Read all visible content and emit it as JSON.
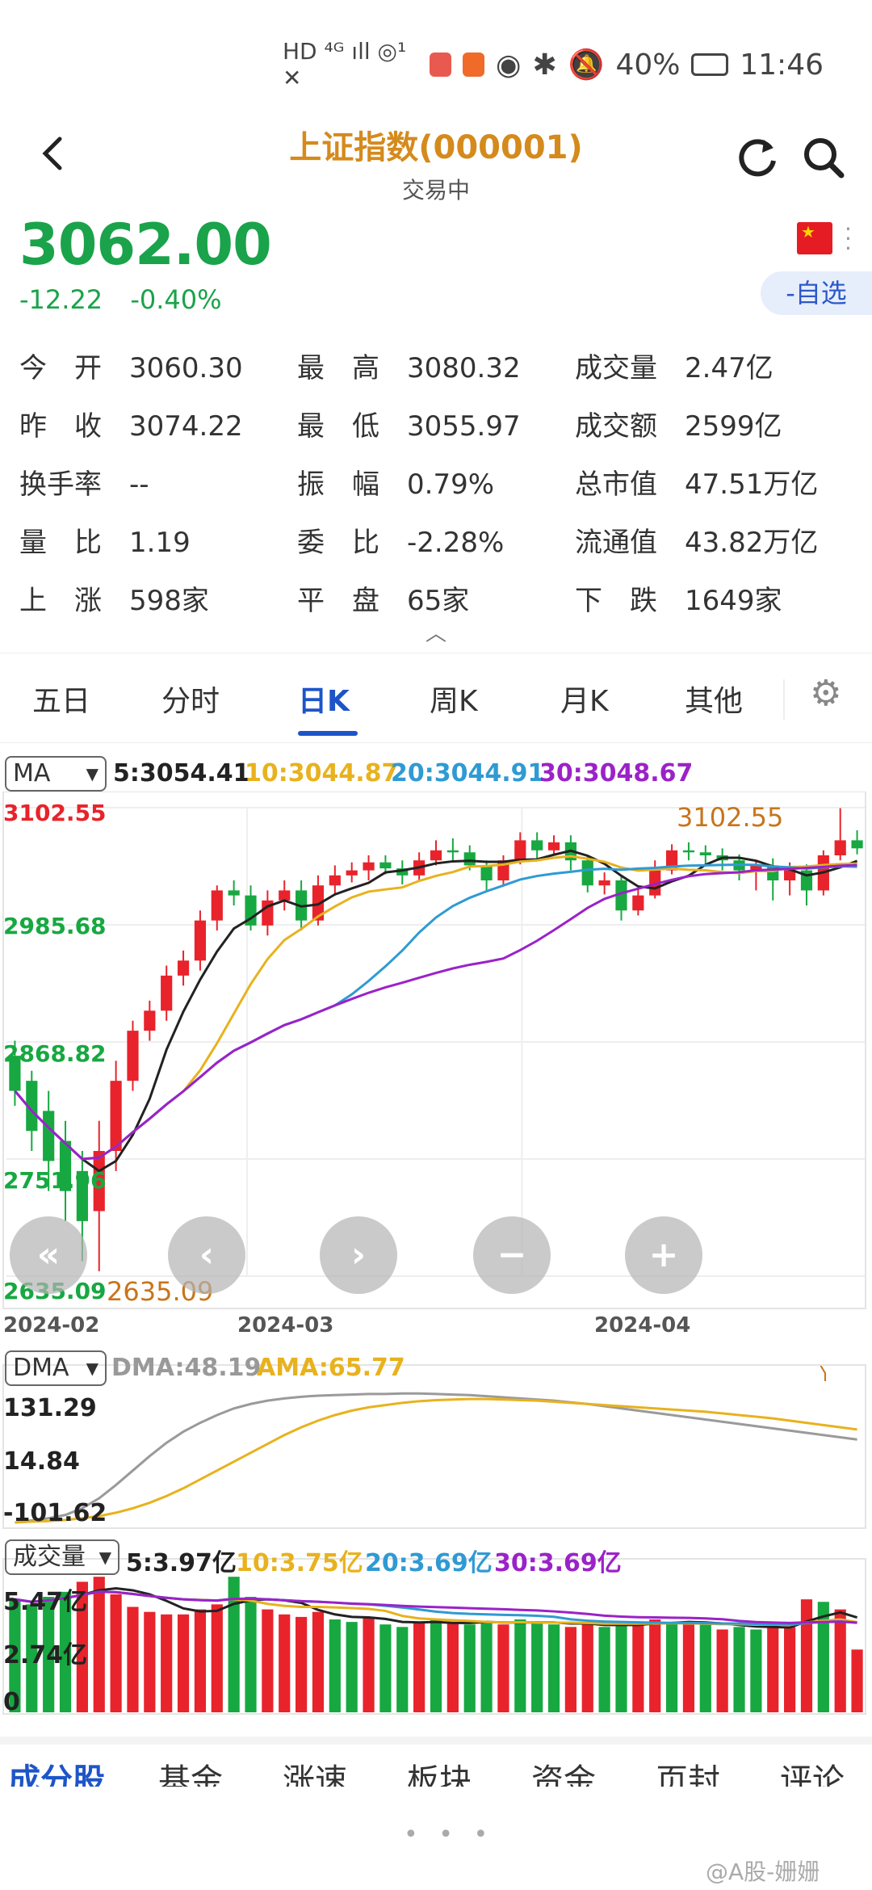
{
  "status_bar": {
    "left_icons": "HD ⁴ᴳ ıll ◎¹ ✕",
    "battery": "40%",
    "time": "11:46"
  },
  "header": {
    "title": "上证指数(000001)",
    "subtitle": "交易中",
    "back_icon": "chevron-left-icon",
    "refresh_icon": "refresh-icon",
    "search_icon": "search-icon"
  },
  "price": {
    "value": "3062.00",
    "change": "-12.22",
    "change_pct": "-0.40%",
    "watch_label": "-自选"
  },
  "quote": [
    [
      {
        "label": "今　开",
        "value": "3060.30"
      },
      {
        "label": "最　高",
        "value": "3080.32"
      },
      {
        "label": "成交量",
        "value": "2.47亿"
      }
    ],
    [
      {
        "label": "昨　收",
        "value": "3074.22"
      },
      {
        "label": "最　低",
        "value": "3055.97"
      },
      {
        "label": "成交额",
        "value": "2599亿"
      }
    ],
    [
      {
        "label": "换手率",
        "value": "--"
      },
      {
        "label": "振　幅",
        "value": "0.79%"
      },
      {
        "label": "总市值",
        "value": "47.51万亿"
      }
    ],
    [
      {
        "label": "量　比",
        "value": "1.19"
      },
      {
        "label": "委　比",
        "value": "-2.28%"
      },
      {
        "label": "流通值",
        "value": "43.82万亿"
      }
    ],
    [
      {
        "label": "上　涨",
        "value": "598家"
      },
      {
        "label": "平　盘",
        "value": "65家"
      },
      {
        "label": "下　跌",
        "value": "1649家"
      }
    ]
  ],
  "tabs": [
    "五日",
    "分时",
    "日K",
    "周K",
    "月K",
    "其他"
  ],
  "active_tab": "日K",
  "ma": {
    "selector": "MA",
    "ma5": "5:3054.41",
    "ma10": "10:3044.87",
    "ma20": "20:3044.91",
    "ma30": "30:3048.67"
  },
  "kline": {
    "y_top": "3102.55",
    "y_mid": "2985.68",
    "y_mid2": "2868.82",
    "y_low": "2751.96",
    "y_bottom": "2635.09",
    "high_note": "3102.55",
    "low_note": "2635.09",
    "dates": [
      "2024-02",
      "2024-03",
      "2024-04"
    ]
  },
  "dma": {
    "selector": "DMA",
    "dma": "DMA:48.19",
    "ama": "AMA:65.77",
    "y_top": "131.29",
    "y_mid": "14.84",
    "y_bottom": "-101.62"
  },
  "vol": {
    "selector": "成交量",
    "v5": "5:3.97亿",
    "v10": "10:3.75亿",
    "v20": "20:3.69亿",
    "v30": "30:3.69亿",
    "y_top": "5.47亿",
    "y_mid": "2.74亿",
    "y_bottom": "0"
  },
  "bottom_tabs": [
    "成分股",
    "基金",
    "涨速",
    "板块",
    "资金",
    "页封",
    "评论"
  ],
  "pager": "• • •",
  "watermark": "@A股-姗姗",
  "colors": {
    "up": "#e8232b",
    "down": "#17a841",
    "ma5": "#222222",
    "ma10": "#e8b21e",
    "ma20": "#2f9ad3",
    "ma30": "#9b22c8",
    "accent": "#1d55c8",
    "title": "#d58a1c"
  },
  "chart_data": {
    "type": "candlestick",
    "period": "daily",
    "ylim": [
      2635.09,
      3102.55
    ],
    "x_ticks": [
      "2024-02",
      "2024-03",
      "2024-04"
    ],
    "candles": [
      [
        2855,
        2820,
        2870,
        2805
      ],
      [
        2830,
        2780,
        2840,
        2760
      ],
      [
        2800,
        2750,
        2820,
        2720
      ],
      [
        2770,
        2720,
        2790,
        2690
      ],
      [
        2740,
        2690,
        2760,
        2650
      ],
      [
        2700,
        2760,
        2790,
        2640
      ],
      [
        2760,
        2830,
        2850,
        2740
      ],
      [
        2830,
        2880,
        2890,
        2820
      ],
      [
        2880,
        2900,
        2910,
        2870
      ],
      [
        2900,
        2935,
        2945,
        2890
      ],
      [
        2935,
        2950,
        2960,
        2925
      ],
      [
        2950,
        2990,
        3000,
        2940
      ],
      [
        2990,
        3020,
        3025,
        2980
      ],
      [
        3020,
        3015,
        3030,
        3005
      ],
      [
        3015,
        2985,
        3025,
        2980
      ],
      [
        2985,
        3010,
        3020,
        2975
      ],
      [
        3010,
        3020,
        3030,
        3000
      ],
      [
        3020,
        2990,
        3030,
        2980
      ],
      [
        2990,
        3025,
        3035,
        2985
      ],
      [
        3025,
        3035,
        3045,
        3015
      ],
      [
        3035,
        3040,
        3048,
        3028
      ],
      [
        3040,
        3048,
        3055,
        3030
      ],
      [
        3048,
        3042,
        3055,
        3036
      ],
      [
        3042,
        3035,
        3050,
        3026
      ],
      [
        3035,
        3050,
        3058,
        3030
      ],
      [
        3050,
        3060,
        3070,
        3045
      ],
      [
        3060,
        3058,
        3072,
        3050
      ],
      [
        3058,
        3045,
        3065,
        3040
      ],
      [
        3045,
        3030,
        3050,
        3020
      ],
      [
        3030,
        3050,
        3055,
        3025
      ],
      [
        3050,
        3070,
        3078,
        3046
      ],
      [
        3070,
        3060,
        3078,
        3052
      ],
      [
        3060,
        3068,
        3075,
        3055
      ],
      [
        3068,
        3050,
        3075,
        3040
      ],
      [
        3050,
        3025,
        3055,
        3018
      ],
      [
        3025,
        3030,
        3038,
        3016
      ],
      [
        3030,
        3000,
        3035,
        2990
      ],
      [
        3000,
        3015,
        3022,
        2995
      ],
      [
        3015,
        3040,
        3050,
        3012
      ],
      [
        3040,
        3060,
        3066,
        3036
      ],
      [
        3060,
        3058,
        3068,
        3050
      ],
      [
        3058,
        3055,
        3065,
        3046
      ],
      [
        3055,
        3050,
        3062,
        3040
      ],
      [
        3050,
        3040,
        3056,
        3030
      ],
      [
        3040,
        3045,
        3050,
        3020
      ],
      [
        3045,
        3030,
        3052,
        3010
      ],
      [
        3030,
        3040,
        3048,
        3015
      ],
      [
        3040,
        3020,
        3046,
        3005
      ],
      [
        3020,
        3055,
        3060,
        3015
      ],
      [
        3055,
        3070,
        3102,
        3050
      ],
      [
        3070,
        3062,
        3080,
        3056
      ]
    ],
    "dma_series": {
      "dma": [
        -101.6,
        -98,
        -94,
        -88,
        -76,
        -58,
        -34,
        -8,
        18,
        42,
        62,
        78,
        92,
        104,
        112,
        118,
        122,
        125,
        127,
        128,
        129,
        130,
        130,
        131,
        131,
        130,
        129,
        128,
        126,
        124,
        122,
        120,
        118,
        115,
        112,
        108,
        104,
        100,
        96,
        92,
        88,
        84,
        80,
        76,
        72,
        68,
        64,
        60,
        56,
        52,
        48
      ],
      "ama": [
        -101.6,
        -100,
        -99,
        -97,
        -94,
        -90,
        -84,
        -76,
        -66,
        -54,
        -40,
        -24,
        -8,
        8,
        24,
        40,
        56,
        70,
        82,
        92,
        100,
        106,
        110,
        114,
        117,
        119,
        120,
        121,
        121,
        120,
        119,
        118,
        116,
        114,
        112,
        110,
        108,
        106,
        104,
        102,
        100,
        98,
        95,
        92,
        89,
        86,
        82,
        78,
        74,
        70,
        66
      ]
    },
    "volume": [
      [
        4.5,
        0
      ],
      [
        4.3,
        0
      ],
      [
        4.6,
        0
      ],
      [
        4.8,
        0
      ],
      [
        5.2,
        1
      ],
      [
        5.4,
        1
      ],
      [
        4.7,
        1
      ],
      [
        4.2,
        1
      ],
      [
        4.0,
        1
      ],
      [
        3.9,
        1
      ],
      [
        3.9,
        1
      ],
      [
        4.1,
        1
      ],
      [
        4.3,
        1
      ],
      [
        5.4,
        0
      ],
      [
        4.6,
        0
      ],
      [
        4.1,
        1
      ],
      [
        3.9,
        1
      ],
      [
        3.8,
        1
      ],
      [
        4.0,
        1
      ],
      [
        3.7,
        0
      ],
      [
        3.6,
        0
      ],
      [
        3.8,
        1
      ],
      [
        3.5,
        0
      ],
      [
        3.4,
        0
      ],
      [
        3.6,
        1
      ],
      [
        3.7,
        0
      ],
      [
        3.6,
        1
      ],
      [
        3.5,
        0
      ],
      [
        3.6,
        0
      ],
      [
        3.5,
        1
      ],
      [
        3.7,
        0
      ],
      [
        3.6,
        0
      ],
      [
        3.5,
        0
      ],
      [
        3.4,
        1
      ],
      [
        3.5,
        1
      ],
      [
        3.4,
        0
      ],
      [
        3.6,
        0
      ],
      [
        3.5,
        1
      ],
      [
        3.7,
        1
      ],
      [
        3.6,
        0
      ],
      [
        3.6,
        1
      ],
      [
        3.5,
        0
      ],
      [
        3.3,
        1
      ],
      [
        3.4,
        0
      ],
      [
        3.3,
        0
      ],
      [
        3.5,
        1
      ],
      [
        3.4,
        1
      ],
      [
        4.5,
        1
      ],
      [
        4.4,
        0
      ],
      [
        4.1,
        1
      ],
      [
        2.5,
        1
      ]
    ]
  }
}
